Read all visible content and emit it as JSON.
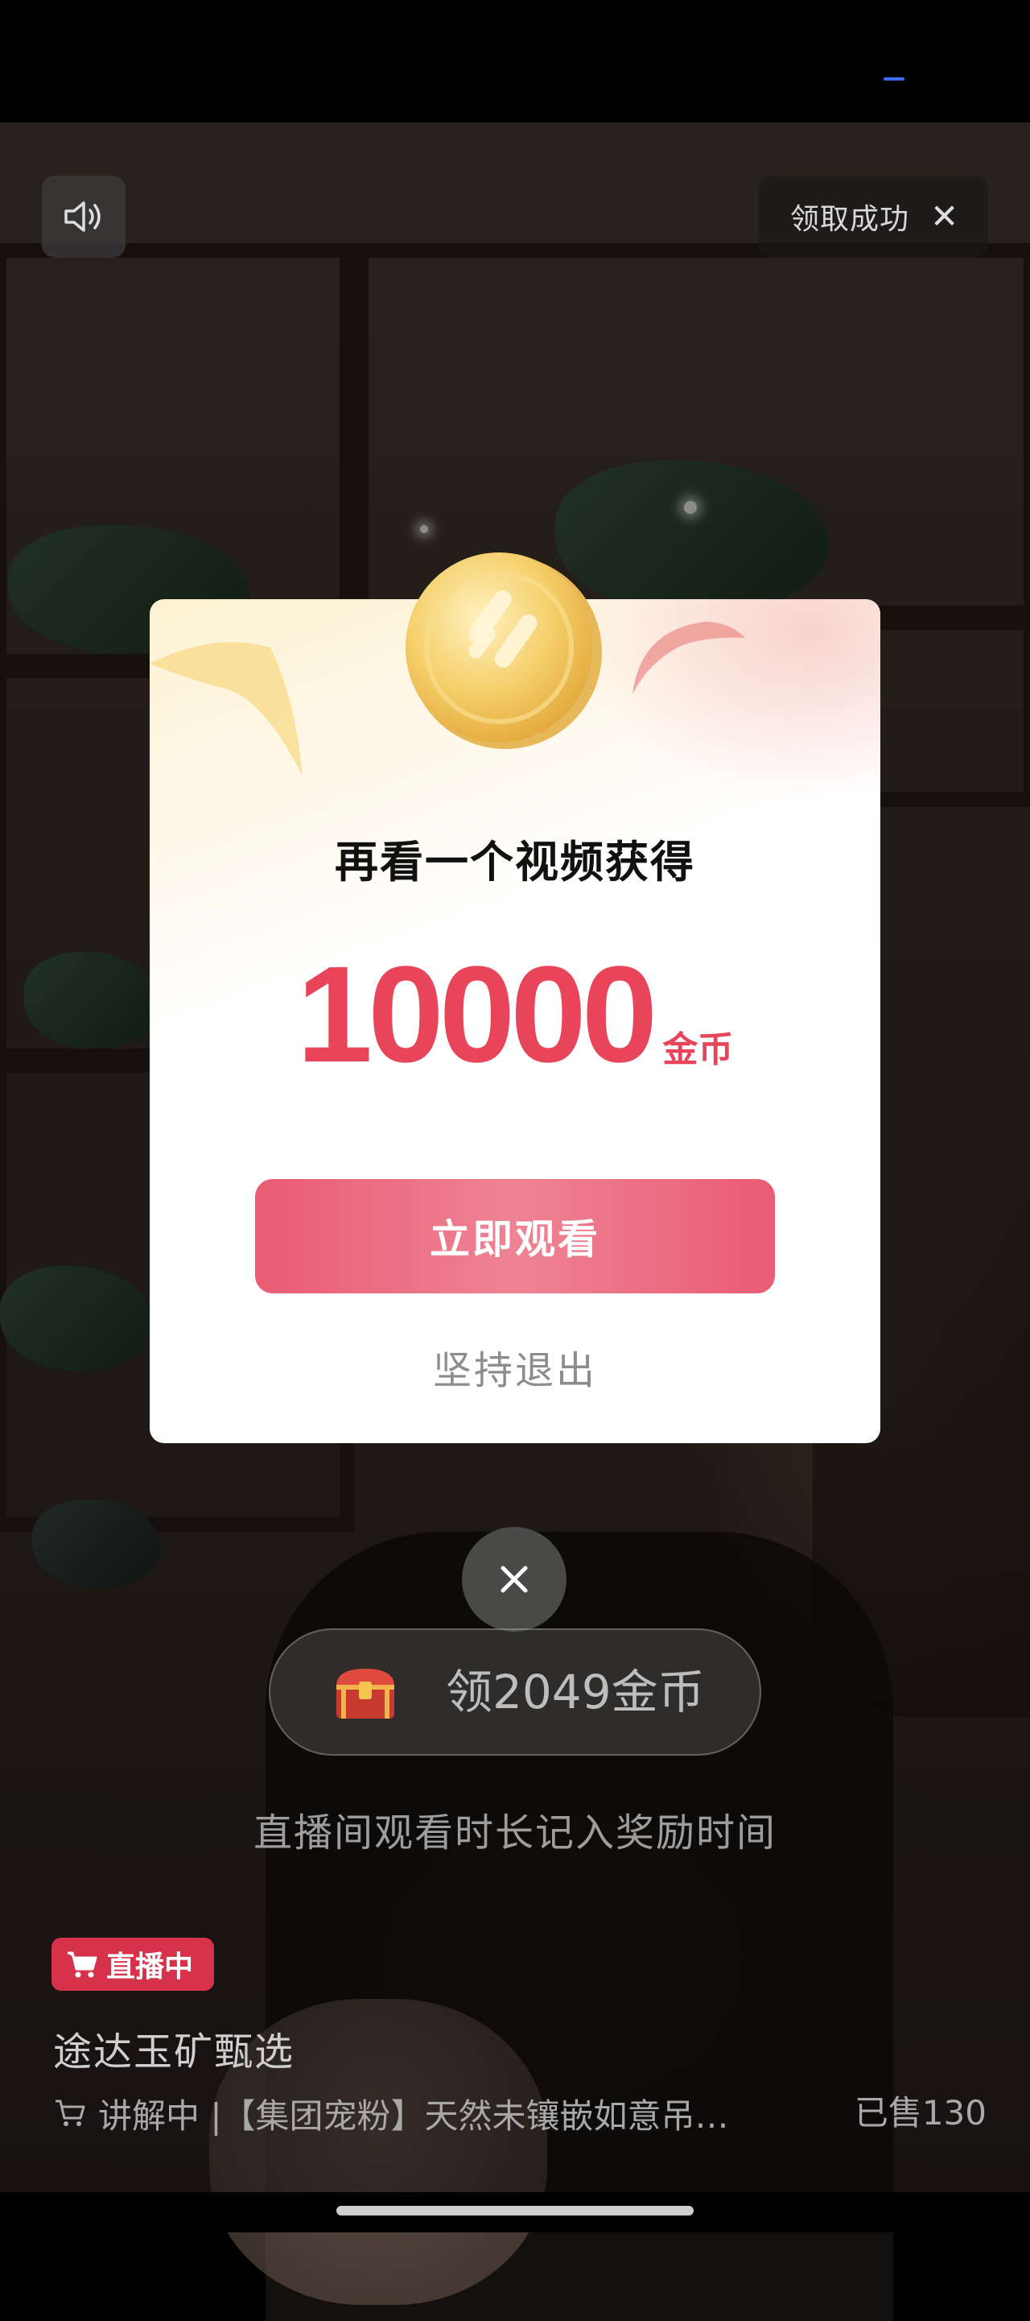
{
  "top_bar": {
    "claim_success": "领取成功"
  },
  "dialog": {
    "title": "再看一个视频获得",
    "amount": "10000",
    "unit": "金币",
    "watch_button": "立即观看",
    "exit_link": "坚持退出"
  },
  "coin_pill": {
    "label": "领2049金币"
  },
  "live_note": "直播间观看时长记入奖励时间",
  "stream": {
    "badge": "直播中",
    "store_name": "途达玉矿甄选",
    "product": "讲解中 |【集团宠粉】天然未镶嵌如意吊…",
    "sold": "已售130"
  },
  "colors": {
    "accent": "#e8455a",
    "badge": "#d6324c",
    "button": "#ea5c72"
  },
  "icons": [
    "speaker-icon",
    "close-icon",
    "coin-icon",
    "treasure-chest-icon",
    "cart-icon"
  ]
}
